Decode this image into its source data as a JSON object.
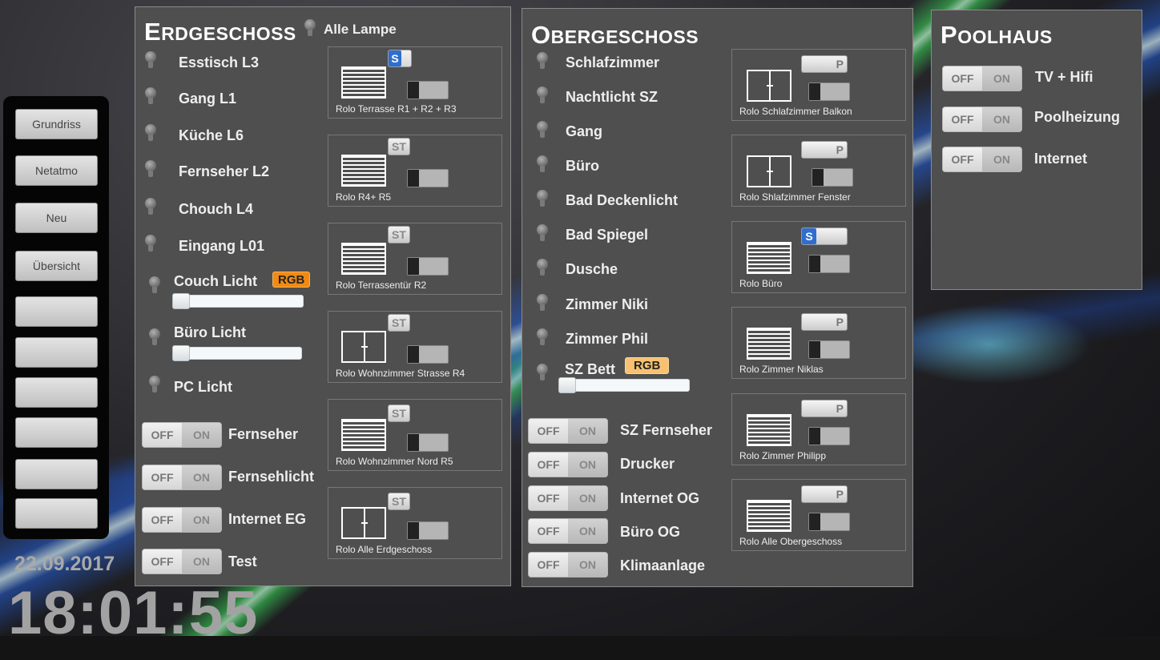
{
  "nav": {
    "buttons": [
      "Grundriss",
      "Netatmo",
      "Neu",
      "Übersicht",
      "",
      "",
      "",
      "",
      "",
      ""
    ]
  },
  "clock": {
    "date": "22.09.2017",
    "time": "18:01:55"
  },
  "eg": {
    "title_first": "E",
    "title_rest": "RDGESCHOSS",
    "all_lamps": "Alle Lampe",
    "lamps": [
      "Esstisch L3",
      "Gang L1",
      "Küche L6",
      "Fernseher L2",
      "Chouch L4",
      "Eingang L01"
    ],
    "dimmers": [
      {
        "label": "Couch Licht",
        "rgb": "RGB"
      },
      {
        "label": "Büro Licht"
      }
    ],
    "pc_light": "PC Licht",
    "switches": [
      {
        "label": "Fernseher",
        "off": "OFF",
        "on": "ON"
      },
      {
        "label": "Fernsehlicht",
        "off": "OFF",
        "on": "ON"
      },
      {
        "label": "Internet EG",
        "off": "OFF",
        "on": "ON"
      },
      {
        "label": "Test",
        "off": "OFF",
        "on": "ON"
      }
    ],
    "rolos": [
      {
        "caption": "Rolo Terrasse R1 + R2 + R3",
        "icon": "blind",
        "button": "S",
        "active": true
      },
      {
        "caption": "Rolo R4+ R5",
        "icon": "blind",
        "button": "ST",
        "active": false
      },
      {
        "caption": "Rolo Terrassentür R2",
        "icon": "blind",
        "button": "ST",
        "active": false
      },
      {
        "caption": "Rolo Wohnzimmer Strasse R4",
        "icon": "window",
        "button": "ST",
        "active": false
      },
      {
        "caption": "Rolo Wohnzimmer Nord R5",
        "icon": "blind",
        "button": "ST",
        "active": false
      },
      {
        "caption": "Rolo Alle Erdgeschoss",
        "icon": "window",
        "button": "ST",
        "active": false
      }
    ]
  },
  "og": {
    "title_first": "O",
    "title_rest": "BERGESCHOSS",
    "lamps": [
      "Schlafzimmer",
      "Nachtlicht SZ",
      "Gang",
      "Büro",
      "Bad Deckenlicht",
      "Bad Spiegel",
      "Dusche",
      "Zimmer Niki",
      "Zimmer Phil"
    ],
    "dimmer": {
      "label": "SZ Bett",
      "rgb": "RGB"
    },
    "switches": [
      {
        "label": "SZ Fernseher",
        "off": "OFF",
        "on": "ON"
      },
      {
        "label": "Drucker",
        "off": "OFF",
        "on": "ON"
      },
      {
        "label": "Internet OG",
        "off": "OFF",
        "on": "ON"
      },
      {
        "label": "Büro OG",
        "off": "OFF",
        "on": "ON"
      },
      {
        "label": "Klimaanlage",
        "off": "OFF",
        "on": "ON"
      }
    ],
    "rolos": [
      {
        "caption": "Rolo Schlafzimmer Balkon",
        "icon": "window",
        "button": "P",
        "active": false
      },
      {
        "caption": "Rolo Shlafzimmer Fenster",
        "icon": "window",
        "button": "P",
        "active": false
      },
      {
        "caption": "Rolo Büro",
        "icon": "blind",
        "button": "S",
        "active": true
      },
      {
        "caption": "Rolo Zimmer Niklas",
        "icon": "blind",
        "button": "P",
        "active": false
      },
      {
        "caption": "Rolo Zimmer Philipp",
        "icon": "blind",
        "button": "P",
        "active": false
      },
      {
        "caption": "Rolo Alle Obergeschoss",
        "icon": "blind",
        "button": "P",
        "active": false
      }
    ]
  },
  "ph": {
    "title_first": "P",
    "title_rest": "OOLHAUS",
    "switches": [
      {
        "label": "TV + Hifi",
        "off": "OFF",
        "on": "ON"
      },
      {
        "label": "Poolheizung",
        "off": "OFF",
        "on": "ON"
      },
      {
        "label": "Internet",
        "off": "OFF",
        "on": "ON"
      }
    ]
  },
  "colors": {
    "panel": "#4f4f4f",
    "rgb_active": "#f08a14",
    "rgb_light": "#f6c170",
    "button_active": "#2f6ed0"
  }
}
